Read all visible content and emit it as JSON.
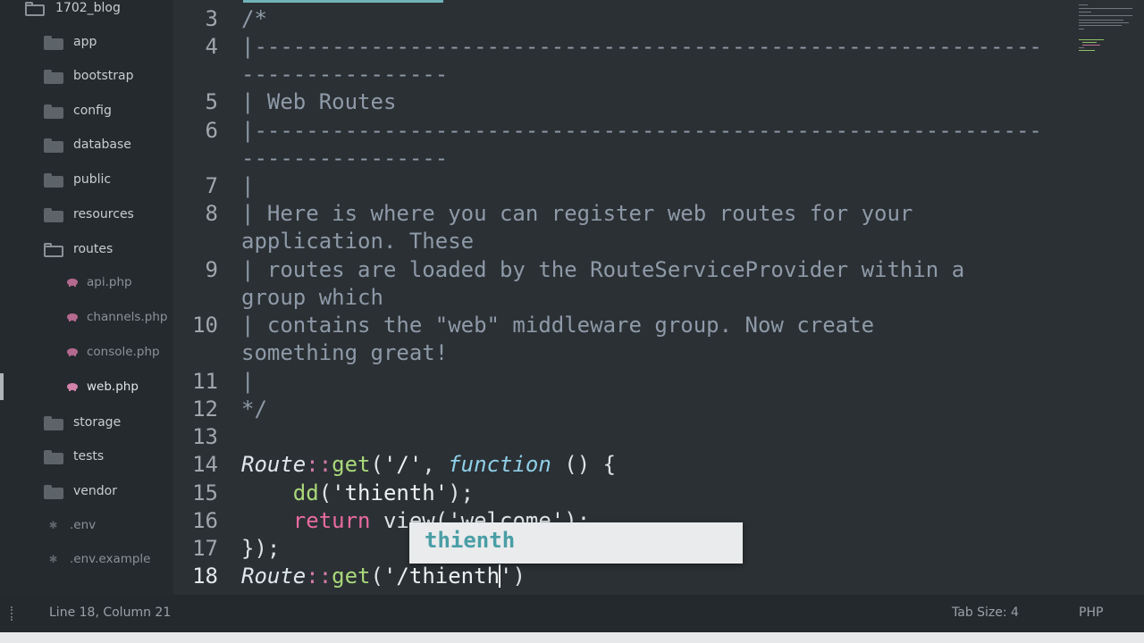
{
  "sidebar": {
    "root": "1702_blog",
    "folders": [
      "app",
      "bootstrap",
      "config",
      "database",
      "public",
      "resources",
      "routes"
    ],
    "route_files": [
      "api.php",
      "channels.php",
      "console.php",
      "web.php"
    ],
    "folders_after": [
      "storage",
      "tests",
      "vendor"
    ],
    "dotfiles": [
      ".env",
      ".env.example"
    ]
  },
  "editor": {
    "line_numbers": [
      "3",
      "4",
      "5",
      "6",
      "7",
      "8",
      "9",
      "10",
      "11",
      "12",
      "13",
      "14",
      "15",
      "16",
      "17",
      "18"
    ],
    "lines": {
      "l3": "/*",
      "l4a": "|-------------------------------------------------------------",
      "l4b": "----------------",
      "l5": "| Web Routes",
      "l6a": "|-------------------------------------------------------------",
      "l6b": "----------------",
      "l7": "|",
      "l8a": "| Here is where you can register web routes for your",
      "l8b": "application. These",
      "l9a": "| routes are loaded by the RouteServiceProvider within a",
      "l9b": "group which",
      "l10a": "| contains the \"web\" middleware group. Now create",
      "l10b": "something great!",
      "l11": "|",
      "l12": "*/"
    },
    "code": {
      "route": "Route",
      "scope": "::",
      "get": "get",
      "open_paren": "(",
      "slash_str": "'/'",
      "comma": ", ",
      "function_kw": "function",
      "args": " () {",
      "indent": "    ",
      "dd": "dd",
      "thienth_str": "'thienth'",
      "close_stmt": ");",
      "return_kw": "return",
      "view_call": " view('welcome');",
      "closing": "});",
      "l18_str": "'/thienth",
      "l18_quote": "'",
      "l18_close": ")"
    },
    "autocomplete_suggestion": "thienth"
  },
  "statusbar": {
    "position": "Line 18, Column 21",
    "tab_size": "Tab Size: 4",
    "syntax": "PHP"
  }
}
